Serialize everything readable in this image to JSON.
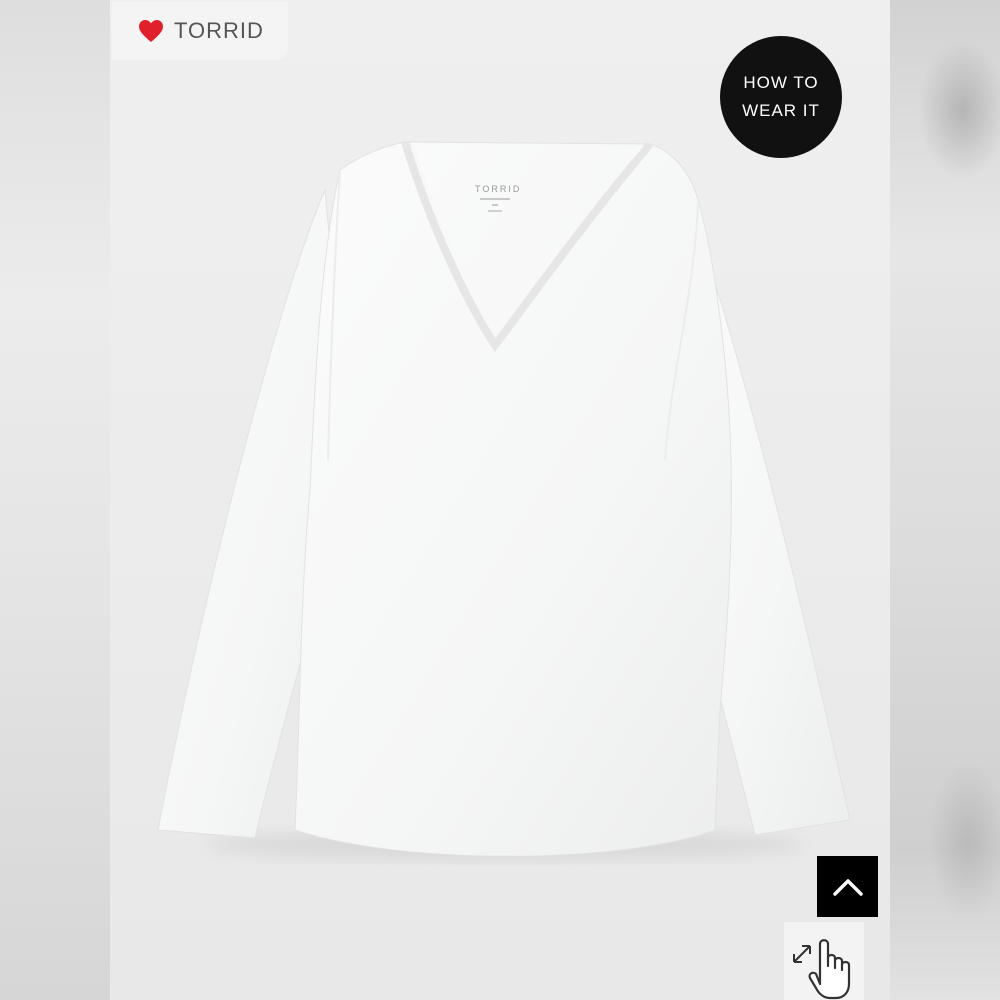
{
  "brand": {
    "name": "TORRID",
    "icon": "heart-icon",
    "heart_color": "#e0202a"
  },
  "product_image": {
    "neck_label": "TORRID"
  },
  "how_to_wear": {
    "line1": "HOW TO",
    "line2": "WEAR IT"
  },
  "controls": {
    "back_to_top_icon": "chevron-up-icon",
    "zoom_icon": "pinch-zoom-hand-icon"
  }
}
